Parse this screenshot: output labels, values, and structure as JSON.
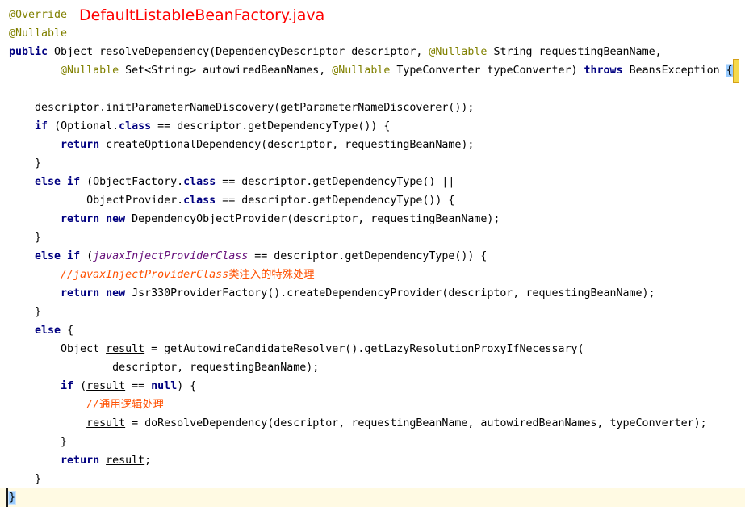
{
  "title_overlay": "DefaultListableBeanFactory.java",
  "code_lines": [
    {
      "tokens": [
        {
          "t": "@Override",
          "c": "ann"
        }
      ]
    },
    {
      "tokens": [
        {
          "t": "@Nullable",
          "c": "ann"
        }
      ]
    },
    {
      "tokens": [
        {
          "t": "public ",
          "c": "kw"
        },
        {
          "t": "Object resolveDependency(DependencyDescriptor descriptor, "
        },
        {
          "t": "@Nullable",
          "c": "ann"
        },
        {
          "t": " String requestingBeanName,"
        }
      ]
    },
    {
      "tokens": [
        {
          "t": "        "
        },
        {
          "t": "@Nullable",
          "c": "ann"
        },
        {
          "t": " Set<String> autowiredBeanNames, "
        },
        {
          "t": "@Nullable",
          "c": "ann"
        },
        {
          "t": " TypeConverter typeConverter) "
        },
        {
          "t": "throws ",
          "c": "kw"
        },
        {
          "t": "BeansException "
        },
        {
          "t": "{",
          "c": "brace-hl"
        }
      ]
    },
    {
      "tokens": []
    },
    {
      "tokens": [
        {
          "t": "    descriptor.initParameterNameDiscovery(getParameterNameDiscoverer());"
        }
      ]
    },
    {
      "tokens": [
        {
          "t": "    "
        },
        {
          "t": "if ",
          "c": "kw"
        },
        {
          "t": "(Optional."
        },
        {
          "t": "class ",
          "c": "kw"
        },
        {
          "t": "== descriptor.getDependencyType()) {"
        }
      ]
    },
    {
      "tokens": [
        {
          "t": "        "
        },
        {
          "t": "return ",
          "c": "kw"
        },
        {
          "t": "createOptionalDependency(descriptor, requestingBeanName);"
        }
      ]
    },
    {
      "tokens": [
        {
          "t": "    }"
        }
      ]
    },
    {
      "tokens": [
        {
          "t": "    "
        },
        {
          "t": "else if ",
          "c": "kw"
        },
        {
          "t": "(ObjectFactory."
        },
        {
          "t": "class ",
          "c": "kw"
        },
        {
          "t": "== descriptor.getDependencyType() ||"
        }
      ]
    },
    {
      "tokens": [
        {
          "t": "            ObjectProvider."
        },
        {
          "t": "class ",
          "c": "kw"
        },
        {
          "t": "== descriptor.getDependencyType()) {"
        }
      ]
    },
    {
      "tokens": [
        {
          "t": "        "
        },
        {
          "t": "return new ",
          "c": "kw"
        },
        {
          "t": "DependencyObjectProvider(descriptor, requestingBeanName);"
        }
      ]
    },
    {
      "tokens": [
        {
          "t": "    }"
        }
      ]
    },
    {
      "tokens": [
        {
          "t": "    "
        },
        {
          "t": "else if ",
          "c": "kw"
        },
        {
          "t": "("
        },
        {
          "t": "javaxInjectProviderClass",
          "c": "fld"
        },
        {
          "t": " == descriptor.getDependencyType()) {"
        }
      ]
    },
    {
      "tokens": [
        {
          "t": "        "
        },
        {
          "t": "//javaxInjectProviderClass",
          "c": "cmt"
        },
        {
          "t": "类注入的特殊处理",
          "c": "cmt-cn"
        }
      ]
    },
    {
      "tokens": [
        {
          "t": "        "
        },
        {
          "t": "return new ",
          "c": "kw"
        },
        {
          "t": "Jsr330ProviderFactory().createDependencyProvider(descriptor, requestingBeanName);"
        }
      ]
    },
    {
      "tokens": [
        {
          "t": "    }"
        }
      ]
    },
    {
      "tokens": [
        {
          "t": "    "
        },
        {
          "t": "else ",
          "c": "kw"
        },
        {
          "t": "{"
        }
      ]
    },
    {
      "tokens": [
        {
          "t": "        Object "
        },
        {
          "t": "result",
          "c": "ul"
        },
        {
          "t": " = getAutowireCandidateResolver().getLazyResolutionProxyIfNecessary("
        }
      ]
    },
    {
      "tokens": [
        {
          "t": "                descriptor, requestingBeanName);"
        }
      ]
    },
    {
      "tokens": [
        {
          "t": "        "
        },
        {
          "t": "if ",
          "c": "kw"
        },
        {
          "t": "("
        },
        {
          "t": "result",
          "c": "ul"
        },
        {
          "t": " == "
        },
        {
          "t": "null",
          "c": "kw"
        },
        {
          "t": ") {"
        }
      ]
    },
    {
      "tokens": [
        {
          "t": "            "
        },
        {
          "t": "//",
          "c": "cmt"
        },
        {
          "t": "通用逻辑处理",
          "c": "cmt-cn"
        }
      ]
    },
    {
      "tokens": [
        {
          "t": "            "
        },
        {
          "t": "result",
          "c": "ul"
        },
        {
          "t": " = doResolveDependency(descriptor, requestingBeanName, autowiredBeanNames, typeConverter);"
        }
      ]
    },
    {
      "tokens": [
        {
          "t": "        }"
        }
      ]
    },
    {
      "tokens": [
        {
          "t": "        "
        },
        {
          "t": "return ",
          "c": "kw"
        },
        {
          "t": "result",
          "c": "ul"
        },
        {
          "t": ";"
        }
      ]
    },
    {
      "tokens": [
        {
          "t": "    }"
        }
      ]
    },
    {
      "tokens": [
        {
          "t": "}",
          "c": "brace-hl"
        }
      ],
      "current": true
    }
  ]
}
